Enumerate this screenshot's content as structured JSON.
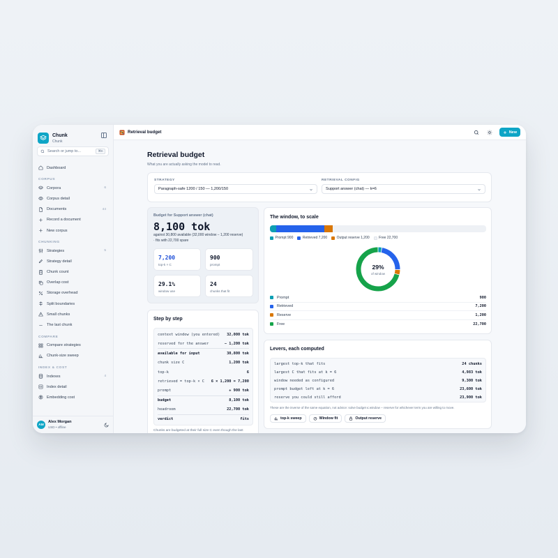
{
  "app": {
    "name": "Chunk",
    "subtitle": "Chunk"
  },
  "sidebar": {
    "search_placeholder": "Search or jump to...",
    "search_shortcut": "⌘K",
    "dashboard": "Dashboard",
    "sections": [
      {
        "label": "CORPUS",
        "items": [
          {
            "label": "Corpora",
            "count": "6",
            "icon": "layers-icon"
          },
          {
            "label": "Corpus detail",
            "count": "",
            "icon": "eye-icon"
          },
          {
            "label": "Documents",
            "count": "44",
            "icon": "document-icon"
          },
          {
            "label": "Record a document",
            "count": "",
            "icon": "plus-icon"
          },
          {
            "label": "New corpus",
            "count": "",
            "icon": "plus-square-icon"
          }
        ]
      },
      {
        "label": "CHUNKING",
        "items": [
          {
            "label": "Strategies",
            "count": "5",
            "icon": "sliders-icon"
          },
          {
            "label": "Strategy detail",
            "count": "",
            "icon": "pencil-icon"
          },
          {
            "label": "Chunk count",
            "count": "",
            "icon": "calculator-icon"
          },
          {
            "label": "Overlap cost",
            "count": "",
            "icon": "copy-icon"
          },
          {
            "label": "Storage overhead",
            "count": "",
            "icon": "percent-icon"
          },
          {
            "label": "Split boundaries",
            "count": "",
            "icon": "split-icon"
          },
          {
            "label": "Small chunks",
            "count": "",
            "icon": "triangle-icon"
          },
          {
            "label": "The last chunk",
            "count": "",
            "icon": "minus-icon"
          }
        ]
      },
      {
        "label": "COMPARE",
        "items": [
          {
            "label": "Compare strategies",
            "count": "",
            "icon": "grid-icon"
          },
          {
            "label": "Chunk-size sweep",
            "count": "",
            "icon": "bar-chart-icon"
          }
        ]
      },
      {
        "label": "INDEX & COST",
        "items": [
          {
            "label": "Indexes",
            "count": "4",
            "icon": "database-icon"
          },
          {
            "label": "Index detail",
            "count": "",
            "icon": "code-icon"
          },
          {
            "label": "Embedding cost",
            "count": "",
            "icon": "dollar-icon"
          }
        ]
      }
    ],
    "user": {
      "initials": "AM",
      "name": "Alex Morgan",
      "meta": "USD • offline"
    }
  },
  "topbar": {
    "title": "Retrieval budget",
    "new_label": "New"
  },
  "page": {
    "title": "Retrieval budget",
    "subtitle": "What you are actually asking the model to read.",
    "strategy_label": "STRATEGY",
    "strategy_value": "Paragraph-safe 1200 / 150 — 1,200/150",
    "config_label": "RETRIEVAL CONFIG",
    "config_value": "Support answer (chat) — k=6"
  },
  "budget": {
    "heading": "Budget for Support answer (chat)",
    "total": "8,100 tok",
    "line1": "against 30,800 available (32,000 window − 1,200 reserve)",
    "line2": "· fits with 22,700 spare",
    "stats": [
      {
        "value": "7,200",
        "label": "top-k × C",
        "accent": "#1d4ed8"
      },
      {
        "value": "900",
        "label": "prompt",
        "accent": "#0f172a"
      },
      {
        "value": "29.1%",
        "label": "window use",
        "accent": "#0f172a"
      },
      {
        "value": "24",
        "label": "chunks that fit",
        "accent": "#0f172a"
      }
    ]
  },
  "steps": {
    "title": "Step by step",
    "rows": [
      {
        "k": "context window (you entered)",
        "v": "32,000 tok",
        "bold": false,
        "sep": false
      },
      {
        "k": "reserved for the answer",
        "v": "− 1,200 tok",
        "bold": false,
        "sep": true
      },
      {
        "k": "available for input",
        "v": "30,800 tok",
        "bold": true,
        "sep": false
      },
      {
        "k": "chunk size C",
        "v": "1,200 tok",
        "bold": false,
        "sep": false
      },
      {
        "k": "top-k",
        "v": "6",
        "bold": false,
        "sep": false
      },
      {
        "k": "retrieved = top-k × C",
        "v": "6 × 1,200 = 7,200",
        "bold": false,
        "sep": false
      },
      {
        "k": "prompt",
        "v": "+ 900 tok",
        "bold": false,
        "sep": true
      },
      {
        "k": "budget",
        "v": "8,100 tok",
        "bold": true,
        "sep": false
      },
      {
        "k": "headroom",
        "v": "22,700 tok",
        "bold": false,
        "sep": true
      },
      {
        "k": "verdict",
        "v": "fits",
        "bold": true,
        "sep": false
      }
    ],
    "footnote": "Chunks are budgeted at their full size C even though the last"
  },
  "window_chart": {
    "title": "The window, to scale",
    "center_value": "29%",
    "center_label": "of window",
    "colors": {
      "prompt": "#0e9fb3",
      "retrieved": "#2563eb",
      "reserve": "#d97706",
      "free": "#16a34a"
    }
  },
  "chart_data": {
    "type": "pie",
    "title": "The window, to scale",
    "total": 32000,
    "series": [
      {
        "name": "Prompt",
        "value": 900,
        "legend": "Prompt 900",
        "row_value": "900"
      },
      {
        "name": "Retrieved",
        "value": 7200,
        "legend": "Retrieved 7,200",
        "row_value": "7,200"
      },
      {
        "name": "Reserve",
        "value": 1200,
        "legend": "Output reserve 1,200",
        "row_value": "1,200"
      },
      {
        "name": "Free",
        "value": 22700,
        "legend": "Free 22,700",
        "row_value": "22,700"
      }
    ]
  },
  "levers": {
    "title": "Levers, each computed",
    "rows": [
      {
        "k": "largest top-k that fits",
        "v": "24 chunks"
      },
      {
        "k": "largest C that fits at k = 6",
        "v": "4,983 tok"
      },
      {
        "k": "window needed as configured",
        "v": "9,300 tok"
      },
      {
        "k": "prompt budget left at k = 6",
        "v": "23,600 tok"
      },
      {
        "k": "reserve you could still afford",
        "v": "23,900 tok"
      }
    ],
    "note": "These are the inverse of the same equation, not advice: solve budget ≤ window − reserve for whichever term you are willing to move.",
    "buttons": [
      "top-k sweep",
      "Window fit",
      "Output reserve"
    ]
  }
}
